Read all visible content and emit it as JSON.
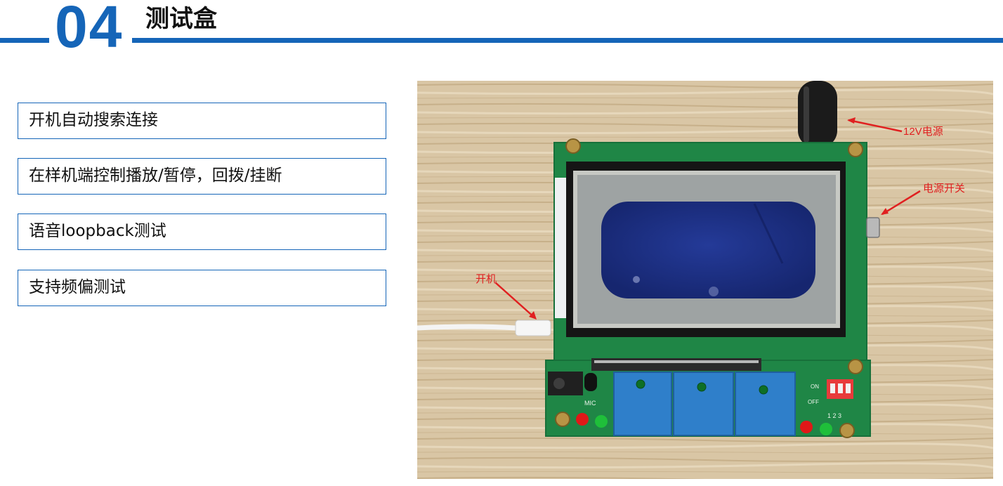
{
  "colors": {
    "accent": "#1565b8",
    "annotation": "#e02020",
    "board_green": "#21884a",
    "lcd_blue": "#1c2f86"
  },
  "header": {
    "number": "04",
    "title": "测试盒"
  },
  "features": [
    {
      "label": "开机自动搜索连接"
    },
    {
      "label": "在样机端控制播放/暂停，回拨/挂断"
    },
    {
      "label": "语音loopback测试"
    },
    {
      "label": "支持频偏测试"
    }
  ],
  "photo": {
    "annotations": {
      "power_12v": "12V电源",
      "power_switch": "电源开关",
      "boot": "开机"
    },
    "board_labels": {
      "mic": "MIC",
      "on": "ON",
      "off": "OFF",
      "dip": "1 2 3"
    }
  }
}
